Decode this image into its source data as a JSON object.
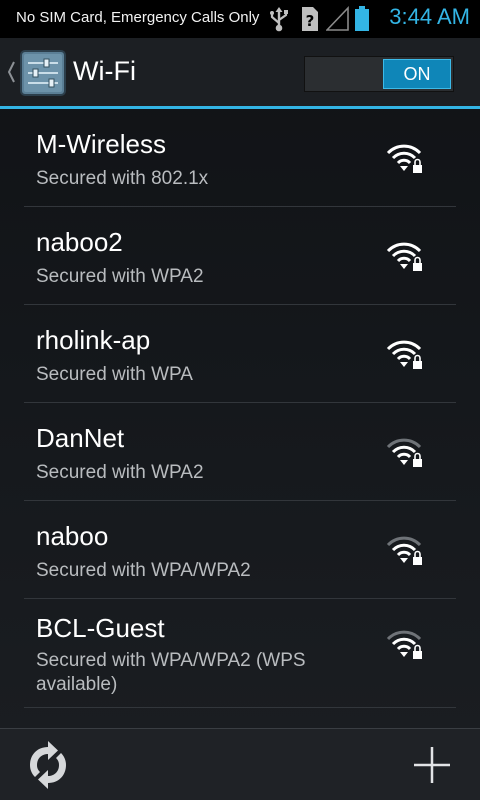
{
  "status_bar": {
    "carrier_text": "No SIM Card, Emergency Calls Only",
    "time": "3:44 AM",
    "icons": [
      "usb-icon",
      "sim-missing-icon",
      "no-signal-icon",
      "battery-icon"
    ],
    "time_color": "#33b5e5"
  },
  "action_bar": {
    "title": "Wi-Fi",
    "icon": "wifi-settings-icon",
    "toggle_label": "ON",
    "accent_color": "#33b5e5"
  },
  "networks": [
    {
      "name": "M-Wireless",
      "security": "Secured with 802.1x",
      "signal": "strong",
      "locked": true
    },
    {
      "name": "naboo2",
      "security": "Secured with WPA2",
      "signal": "strong",
      "locked": true
    },
    {
      "name": "rholink-ap",
      "security": "Secured with WPA",
      "signal": "strong",
      "locked": true
    },
    {
      "name": "DanNet",
      "security": "Secured with WPA2",
      "signal": "medium",
      "locked": true
    },
    {
      "name": "naboo",
      "security": "Secured with WPA/WPA2",
      "signal": "medium",
      "locked": true
    },
    {
      "name": "BCL-Guest",
      "security": "Secured with WPA/WPA2 (WPS available)",
      "signal": "medium",
      "locked": true
    }
  ],
  "bottom_bar": {
    "scan_icon": "scan-refresh-icon",
    "add_icon": "add-network-icon"
  }
}
